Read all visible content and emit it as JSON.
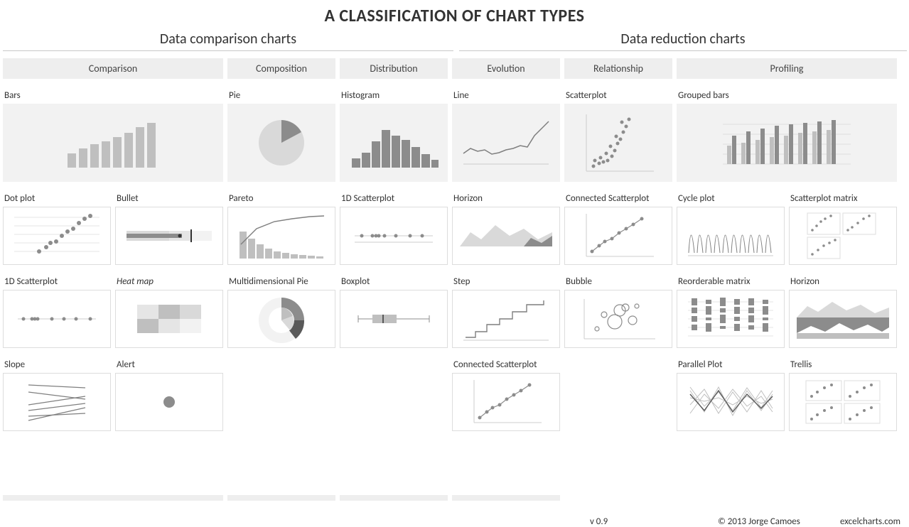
{
  "title": "A CLASSIFICATION OF CHART TYPES",
  "sections": {
    "left": "Data comparison charts",
    "right": "Data reduction charts"
  },
  "categories": {
    "comparison": "Comparison",
    "composition": "Composition",
    "distribution": "Distribution",
    "evolution": "Evolution",
    "relationship": "Relationship",
    "profiling": "Profiling"
  },
  "charts": {
    "r1": {
      "comparison": "Bars",
      "composition": "Pie",
      "distribution": "Histogram",
      "evolution": "Line",
      "relationship": "Scatterplot",
      "profiling": "Grouped bars"
    },
    "r2": {
      "comparison_a": "Dot plot",
      "comparison_b": "Bullet",
      "composition": "Pareto",
      "distribution": "1D Scatterplot",
      "evolution": "Horizon",
      "relationship": "Connected Scatterplot",
      "profiling_a": "Cycle plot",
      "profiling_b": "Scatterplot matrix"
    },
    "r3": {
      "comparison_a": "1D Scatterplot",
      "comparison_b": "Heat map",
      "composition": "Multidimensional Pie",
      "distribution": "Boxplot",
      "evolution": "Step",
      "relationship": "Bubble",
      "profiling_a": "Reorderable matrix",
      "profiling_b": "Horizon"
    },
    "r4": {
      "comparison_a": "Slope",
      "comparison_b": "Alert",
      "evolution": "Connected Scatterplot",
      "profiling_a": "Parallel Plot",
      "profiling_b": "Trellis"
    }
  },
  "footer": {
    "version": "v 0.9",
    "copyright": "© 2013 Jorge Camoes",
    "site": "excelcharts.com"
  },
  "colors": {
    "light": "#d9d9d9",
    "mid": "#a6a6a6",
    "dark": "#808080",
    "bg": "#f2f2f2",
    "line": "#7f7f7f"
  }
}
